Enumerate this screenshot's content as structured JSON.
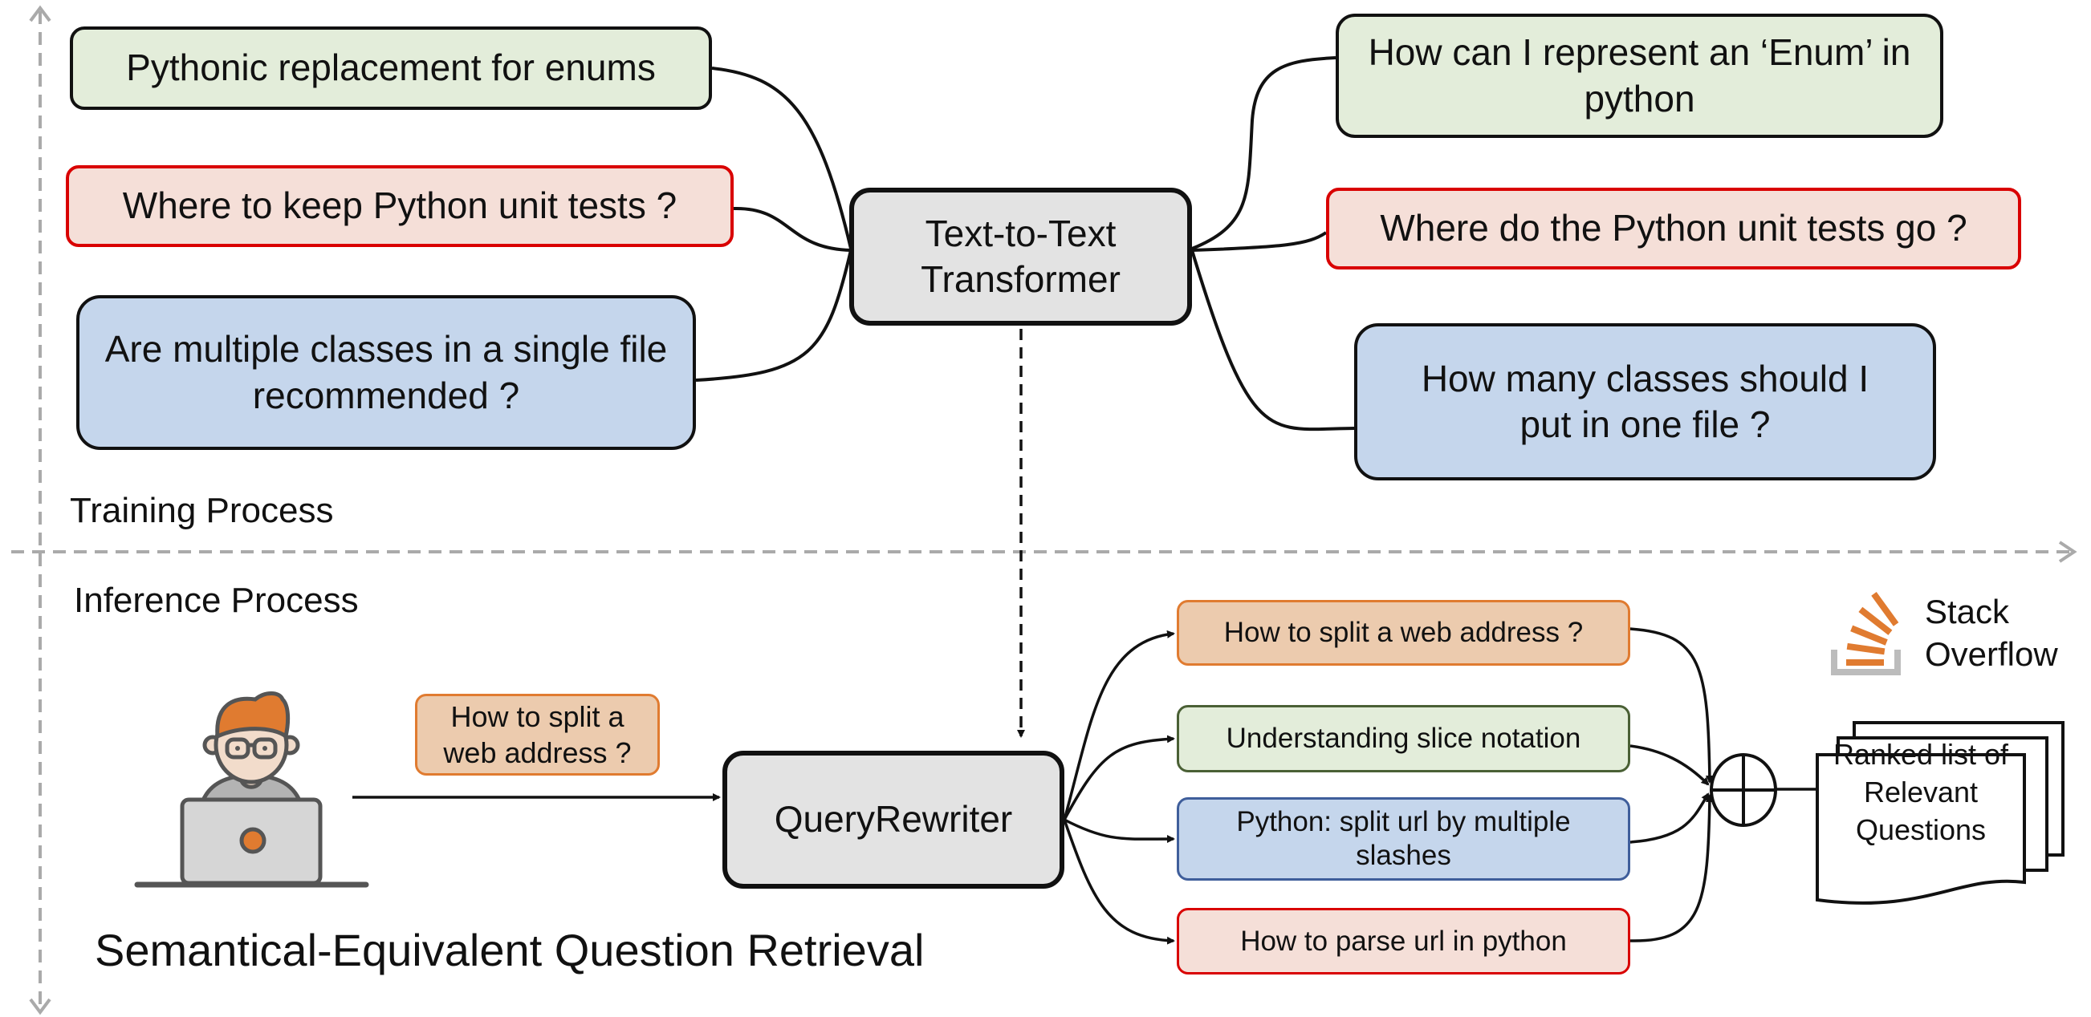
{
  "sections": {
    "training": "Training Process",
    "inference": "Inference Process"
  },
  "title": "Semantical-Equivalent Question Retrieval",
  "training": {
    "model": "Text-to-Text Transformer",
    "left_questions": [
      {
        "text": "Pythonic replacement for enums",
        "color": "green"
      },
      {
        "text": "Where to keep Python unit tests ?",
        "color": "red"
      },
      {
        "text": "Are multiple classes in a single file recommended ?",
        "color": "blue"
      }
    ],
    "right_questions": [
      {
        "text": "How can I represent an ‘Enum’ in python",
        "color": "green"
      },
      {
        "text": "Where do the Python unit tests go ?",
        "color": "red"
      },
      {
        "text": "How many classes should I put in one file ?",
        "color": "blue"
      }
    ]
  },
  "inference": {
    "user_icon": "developer-at-laptop-icon",
    "user_query": "How to split a web address ?",
    "rewriter": "QueryRewriter",
    "candidates": [
      {
        "text": "How to split a web address ?",
        "color": "orange"
      },
      {
        "text": "Understanding slice notation",
        "color": "green"
      },
      {
        "text": "Python: split url by multiple slashes",
        "color": "blue"
      },
      {
        "text": "How to parse url in python",
        "color": "red"
      }
    ],
    "aggregator_icon": "circle-plus-icon",
    "output": "Ranked list of Relevant Questions",
    "source_logo": "stack-overflow-logo",
    "source_name_line1": "Stack",
    "source_name_line2": "Overflow"
  },
  "colors": {
    "green_fill": "#e3edda",
    "red_fill": "#f5dfd8",
    "red_border": "#d90000",
    "blue_fill": "#c5d6ec",
    "orange_fill": "#eccbae",
    "orange_border": "#e07b30",
    "gray_fill": "#e3e3e3",
    "axis_gray": "#aaaaaa",
    "so_orange": "#e07b30"
  }
}
